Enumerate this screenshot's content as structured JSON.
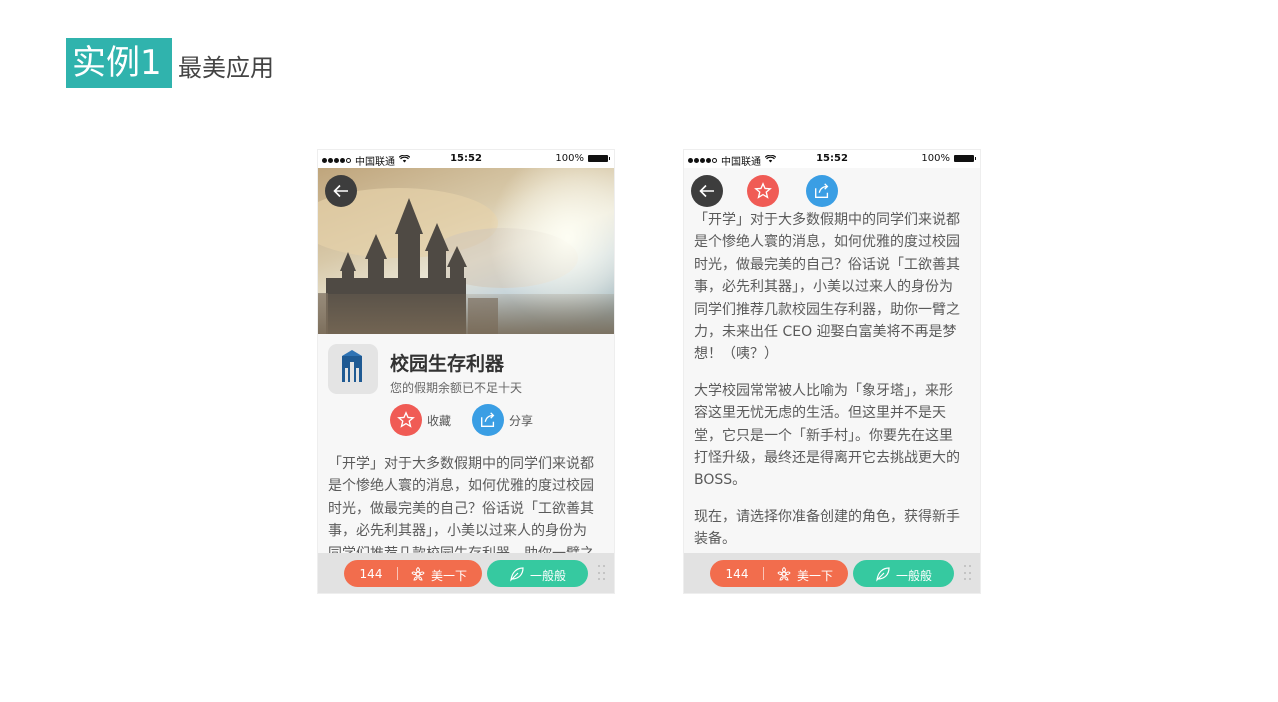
{
  "slide": {
    "badge": "实例1",
    "title": "最美应用"
  },
  "status": {
    "carrier": "中国联通",
    "time": "15:52",
    "battery": "100%"
  },
  "app": {
    "name": "校园生存利器",
    "subtitle": "您的假期余额已不足十天",
    "favorite_label": "收藏",
    "share_label": "分享"
  },
  "article": {
    "p1": "「开学」对于大多数假期中的同学们来说都是个惨绝人寰的消息，如何优雅的度过校园时光，做最完美的自己？俗话说「工欲善其事，必先利其器」，小美以过来人的身份为同学们推荐几款校园生存利器，助你一臂之力，未来出任 CEO 迎娶白富美将不再是梦想！（咦？）",
    "p2": "大学校园常常被人比喻为「象牙塔」，来形容这里无忧无虑的生活。但这里并不是天堂，它只是一个「新手村」。你要先在这里打怪升级，最终还是得离开它去挑战更大的 BOSS。",
    "p3": "现在，请选择你准备创建的角色，获得新手装备。"
  },
  "bottom": {
    "count": "144",
    "like_label": "美一下",
    "meh_label": "一般般"
  },
  "icons": {
    "back": "arrow-left-icon",
    "favorite": "star-icon",
    "share": "share-icon",
    "like": "flower-icon",
    "meh": "leaf-icon",
    "wifi": "wifi-icon",
    "battery": "battery-icon"
  },
  "colors": {
    "accent": "#30b3ad",
    "red": "#f05b55",
    "blue": "#3a9ee4",
    "orange": "#f26d4d",
    "green": "#36c9a0"
  }
}
